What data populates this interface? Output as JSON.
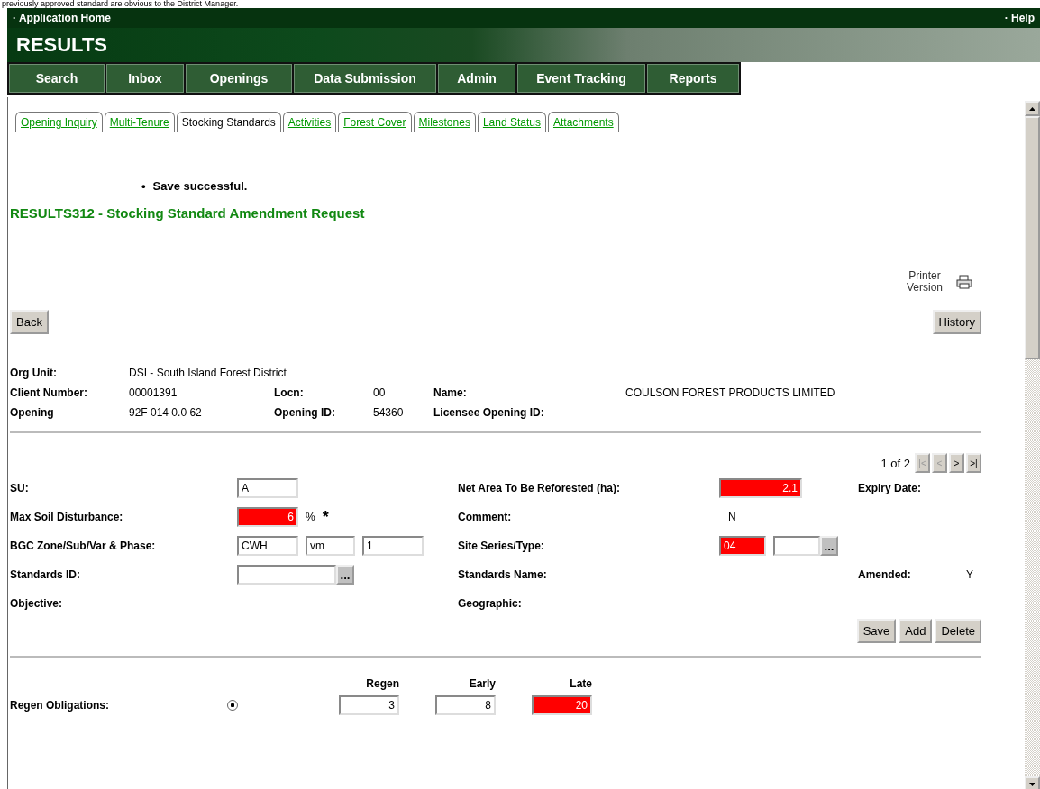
{
  "caption": "previously approved standard are obvious to the District Manager.",
  "header": {
    "home_link": "· Application Home",
    "help_link": "· Help",
    "app_title": "RESULTS"
  },
  "main_menu": [
    {
      "label": "Search"
    },
    {
      "label": "Inbox"
    },
    {
      "label": "Openings"
    },
    {
      "label": "Data Submission"
    },
    {
      "label": "Admin"
    },
    {
      "label": "Event Tracking"
    },
    {
      "label": "Reports"
    }
  ],
  "tabs": [
    {
      "label": "Opening Inquiry",
      "selected": false
    },
    {
      "label": "Multi-Tenure",
      "selected": false
    },
    {
      "label": "Stocking Standards",
      "selected": true
    },
    {
      "label": "Activities",
      "selected": false
    },
    {
      "label": "Forest Cover",
      "selected": false
    },
    {
      "label": "Milestones",
      "selected": false
    },
    {
      "label": "Land Status",
      "selected": false
    },
    {
      "label": "Attachments",
      "selected": false
    }
  ],
  "messages": [
    {
      "marker": "•",
      "text": "Save successful."
    }
  ],
  "page_title": "RESULTS312 - Stocking Standard Amendment Request",
  "printer_link": "Printer Version",
  "back_button": "Back",
  "history_button": "History",
  "summary": [
    [
      {
        "label": "Org Unit:",
        "value": "DSI - South Island Forest District"
      }
    ],
    [
      {
        "label": "Client Number:",
        "value": "00001391"
      },
      {
        "label": "Locn:",
        "value": "00"
      },
      {
        "label": "Name:",
        "value": "COULSON FOREST PRODUCTS LIMITED"
      }
    ],
    [
      {
        "label": "Opening",
        "value": "92F  014  0.0  62"
      },
      {
        "label": "Opening ID:",
        "value": "54360"
      },
      {
        "label": "Licensee Opening ID:"
      }
    ]
  ],
  "pager": {
    "text": "1 of 2",
    "buttons": [
      {
        "label": "|<",
        "disabled": true
      },
      {
        "label": "<",
        "disabled": true
      },
      {
        "label": ">",
        "disabled": false
      },
      {
        "label": ">|",
        "disabled": false
      }
    ]
  },
  "form": [
    [
      {
        "label": "SU:",
        "inputs": [
          {
            "kind": "text",
            "value": "A",
            "flagged": false
          }
        ]
      },
      {
        "label": "Net Area To Be Reforested (ha):",
        "inputs": [
          {
            "kind": "number",
            "value": "2.1",
            "flagged": true
          }
        ]
      },
      {
        "label": "Expiry Date:"
      }
    ],
    [
      {
        "label": "Max Soil Disturbance:",
        "inputs": [
          {
            "kind": "number",
            "value": "6",
            "flagged": true
          }
        ],
        "unit": "%",
        "required_mark": "*"
      },
      {
        "label": "Comment:",
        "value": "N"
      }
    ],
    [
      {
        "label": "BGC Zone/Sub/Var & Phase:",
        "inputs": [
          {
            "kind": "text",
            "value": "CWH",
            "flagged": false
          },
          {
            "kind": "text",
            "value": "vm",
            "flagged": false
          },
          {
            "kind": "text",
            "value": "1",
            "flagged": false
          }
        ]
      },
      {
        "label": "Site Series/Type:",
        "inputs": [
          {
            "kind": "text",
            "value": "04",
            "flagged": true
          },
          {
            "kind": "text",
            "flagged": false
          },
          {
            "kind": "lookup",
            "label": "..."
          }
        ]
      }
    ],
    [
      {
        "label": "Standards ID:",
        "inputs": [
          {
            "kind": "text",
            "flagged": false
          },
          {
            "kind": "lookup",
            "label": "..."
          }
        ]
      },
      {
        "label": "Standards Name:"
      },
      {
        "label": "Amended:",
        "value": "Y"
      }
    ],
    [
      {
        "label": "Objective:"
      },
      {
        "label": "Geographic:"
      }
    ]
  ],
  "row_buttons": [
    "Save",
    "Add",
    "Delete"
  ],
  "regen": {
    "columns": [
      "Regen",
      "Early",
      "Late"
    ],
    "rows": [
      {
        "label": "Regen Obligations:",
        "selected": true,
        "values": [
          {
            "value": "3",
            "flagged": false
          },
          {
            "value": "8",
            "flagged": false
          },
          {
            "value": "20",
            "flagged": true
          }
        ]
      }
    ]
  }
}
